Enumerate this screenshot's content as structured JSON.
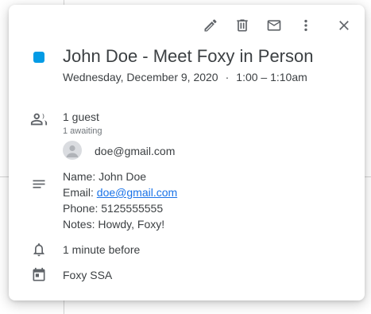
{
  "event": {
    "color": "#039be5",
    "title": "John Doe - Meet Foxy in Person",
    "date": "Wednesday, December 9, 2020",
    "separator": "·",
    "time": "1:00 – 1:10am"
  },
  "guests": {
    "count_label": "1 guest",
    "status_label": "1 awaiting",
    "list": [
      {
        "email": "doe@gmail.com"
      }
    ]
  },
  "description": {
    "name_label": "Name: ",
    "name_value": "John Doe",
    "email_label": "Email: ",
    "email_value": "doe@gmail.com",
    "phone_label": "Phone: ",
    "phone_value": "5125555555",
    "notes_label": "Notes: ",
    "notes_value": "Howdy, Foxy!"
  },
  "reminder": {
    "label": "1 minute before"
  },
  "calendar": {
    "name": "Foxy SSA"
  },
  "toolbar": {
    "icons": [
      "edit-icon",
      "delete-icon",
      "email-icon",
      "more-options-icon",
      "close-icon"
    ]
  }
}
